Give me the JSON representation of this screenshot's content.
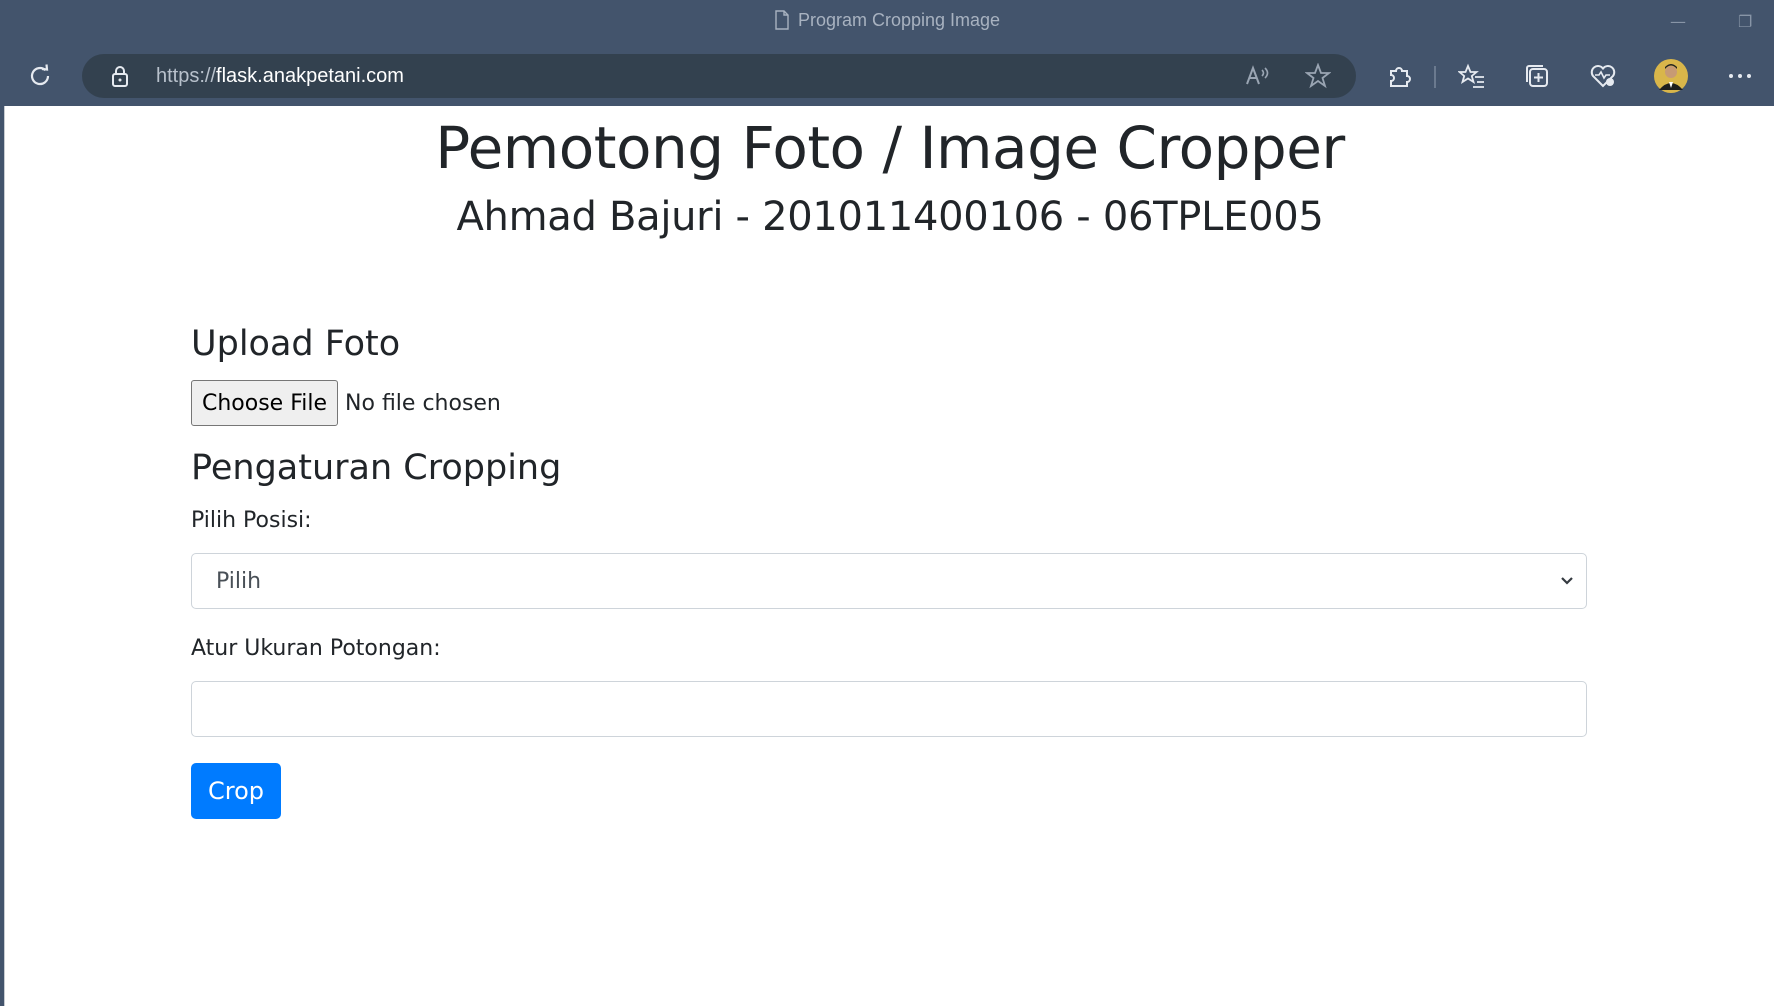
{
  "browser": {
    "tab_title": "Program Cropping Image",
    "url_scheme": "https://",
    "url_host": "flask.anakpetani.com",
    "minimize_glyph": "—",
    "restore_glyph": "❐",
    "icons": [
      "page-icon",
      "refresh-icon",
      "lock-icon",
      "read-aloud-icon",
      "favorite-star-icon",
      "extensions-icon",
      "favorites-list-icon",
      "collections-icon",
      "browser-essentials-icon",
      "profile-avatar",
      "more-menu-icon"
    ]
  },
  "page": {
    "title": "Pemotong Foto / Image Cropper",
    "subtitle": "Ahmad Bajuri - 201011400106 - 06TPLE005",
    "upload": {
      "heading": "Upload Foto",
      "button_label": "Choose File",
      "status": "No file chosen"
    },
    "settings": {
      "heading": "Pengaturan Cropping",
      "position_label": "Pilih Posisi:",
      "position_selected": "Pilih",
      "size_label": "Atur Ukuran Potongan:",
      "size_value": ""
    },
    "crop_button": "Crop"
  },
  "colors": {
    "chrome": "#43546c",
    "addressbar": "#33414f",
    "primary": "#007bff",
    "text": "#212529"
  }
}
